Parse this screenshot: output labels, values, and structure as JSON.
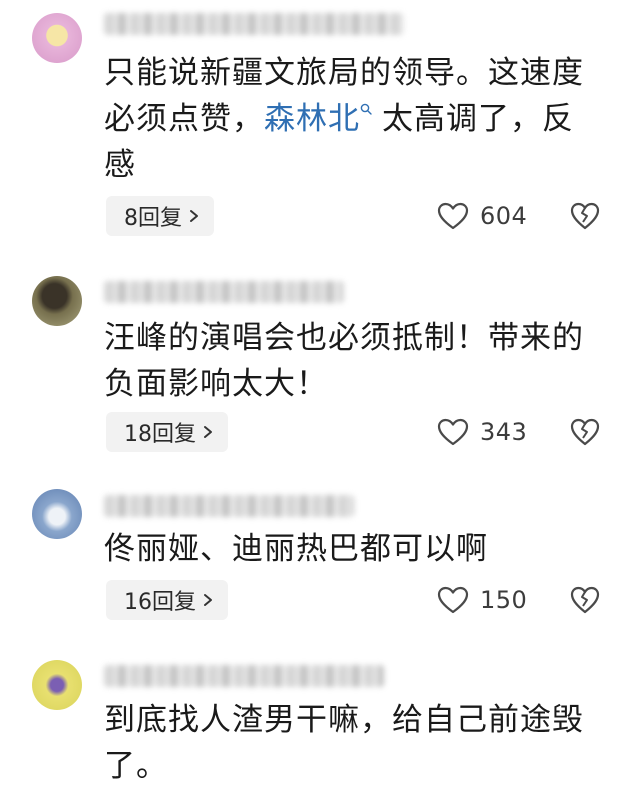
{
  "comments": [
    {
      "text_line1": "只能说新疆文旅局的领导。这速度",
      "text_line2_before": "必须点赞，",
      "text_line2_link": "森林北",
      "text_line2_after": "太高调了，反",
      "text_line3": "感",
      "replies": "8回复",
      "likes": "604"
    },
    {
      "text_line1": "汪峰的演唱会也必须抵制！带来的",
      "text_line2": "负面影响太大！",
      "replies": "18回复",
      "likes": "343"
    },
    {
      "text_line1": "佟丽娅、迪丽热巴都可以啊",
      "replies": "16回复",
      "likes": "150"
    },
    {
      "text_line1": "到底找人渣男干嘛，给自己前途毁",
      "text_line2": "了。"
    }
  ],
  "icons": {
    "like": "heart-outline-icon",
    "dislike": "broken-heart-icon",
    "link_search": "search-icon",
    "reply_arrow": "chevron-right-icon"
  },
  "colors": {
    "link": "#2f6fb3",
    "pill_bg": "#f2f2f2",
    "icon_stroke": "#4a4a4a"
  }
}
